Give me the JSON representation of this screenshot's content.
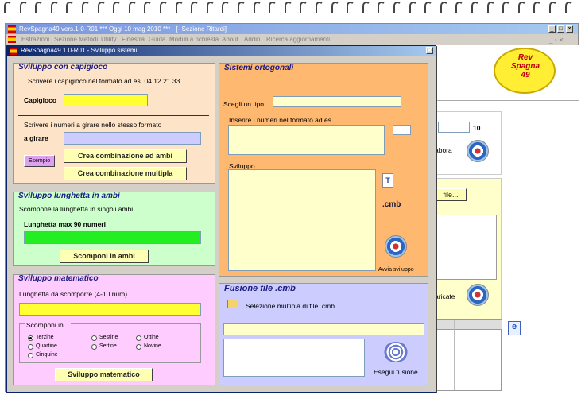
{
  "main_window": {
    "title": "RevSpagna49 vers.1-0-R01  ***  Oggi 10 mag 2010  ***  - [- Sezione Ritardi]",
    "menu": [
      "Estrazioni",
      "Sezione Metodi",
      "Utility",
      "Finestra",
      "Guida",
      "Moduli a richiesta",
      "About",
      "Addin",
      "Ricerca aggiornamenti"
    ],
    "logo_text": "Rev Spagna 49",
    "bg_number": "10",
    "bg_label_elabora": "abora",
    "bg_file_button": "file...",
    "bg_label_caricate": "aricate"
  },
  "sub_window": {
    "title": "RevSpagna49 1.0-R01 - Sviluppo sistemi",
    "close_label": "✕"
  },
  "capigioco": {
    "title": "Sviluppo con capigioco",
    "instruction": "Scrivere i capigioco nel formato ad es. 04.12.21.33",
    "capigioco_label": "Capigioco",
    "capigioco_value": "",
    "instruction2": "Scrivere i numeri a girare nello stesso formato",
    "girare_label": "a girare",
    "girare_value": "",
    "esempio": "Esempio",
    "ambi_button": "Crea combinazione ad ambi",
    "multipla_button": "Crea combinazione multipla"
  },
  "lunghetta": {
    "title": "Sviluppo lunghetta in ambi",
    "instruction": "Scompone la lunghetta in singoli ambi",
    "max_label": "Lunghetta max 90 numeri",
    "value": "",
    "button": "Scomponi in ambi"
  },
  "matematico": {
    "title": "Sviluppo matematico",
    "length_label": "Lunghetta da scomporre (4-10 num)",
    "value": "",
    "scomponi_label": "Scomponi in...",
    "options": [
      "Terzine",
      "Quartine",
      "Cinquine",
      "Sestine",
      "Settine",
      "Ottine",
      "Novine"
    ],
    "selected": "Terzine",
    "button": "Sviluppo matematico"
  },
  "ortogonali": {
    "title": "Sistemi ortogonali",
    "tipo_label": "Scegli un tipo",
    "tipo_value": "",
    "inserire_label": "Inserire i numeri nel formato ad es.",
    "sviluppo_label": "Sviluppo",
    "cmb_label": ".cmb",
    "avvia_label": "Avvia sviluppo"
  },
  "fusione": {
    "title": "Fusione file .cmb",
    "selezione_label": "Selezione multipla di file .cmb",
    "esegui_label": "Esegui fusione"
  }
}
